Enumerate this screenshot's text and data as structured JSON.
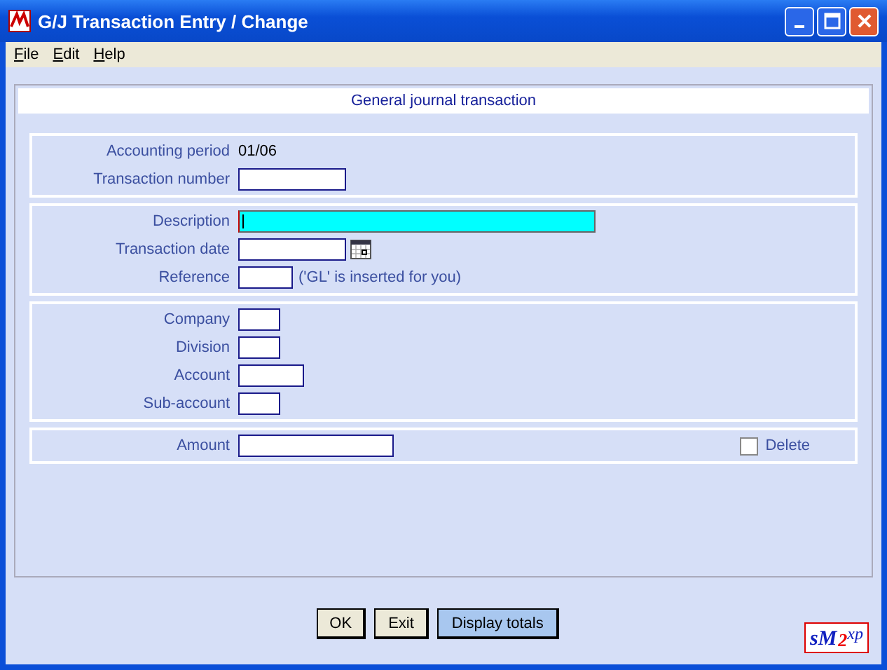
{
  "window": {
    "title": "G/J Transaction Entry / Change"
  },
  "menu": [
    {
      "label": "File"
    },
    {
      "label": "Edit"
    },
    {
      "label": "Help"
    }
  ],
  "header": "General journal transaction",
  "groups": [
    {
      "rows": [
        {
          "label": "Accounting period",
          "kind": "text",
          "value": "01/06"
        },
        {
          "label": "Transaction number",
          "kind": "field",
          "focused": false
        }
      ]
    },
    {
      "rows": [
        {
          "label": "Description",
          "kind": "field",
          "focused": true
        },
        {
          "label": "Transaction  date",
          "kind": "date",
          "focused": false
        },
        {
          "label": "Reference",
          "kind": "field",
          "focused": false,
          "note": "('GL' is inserted for you)"
        }
      ]
    },
    {
      "rows": [
        {
          "label": "Company",
          "kind": "field",
          "focused": false
        },
        {
          "label": "Division",
          "kind": "field",
          "focused": false
        },
        {
          "label": "Account",
          "kind": "field",
          "focused": false
        },
        {
          "label": "Sub-account",
          "kind": "field",
          "focused": false
        }
      ]
    },
    {
      "rows": [
        {
          "label": "Amount",
          "kind": "field",
          "focused": false
        }
      ],
      "checkbox": {
        "label": "Delete",
        "checked": false
      }
    }
  ],
  "buttons": [
    {
      "label": "OK",
      "kind": "default"
    },
    {
      "label": "Exit",
      "kind": "normal"
    },
    {
      "label": "Display totals",
      "kind": "highlighted"
    }
  ],
  "logo": {
    "parts": [
      "s",
      "M",
      "2",
      "xp"
    ]
  }
}
